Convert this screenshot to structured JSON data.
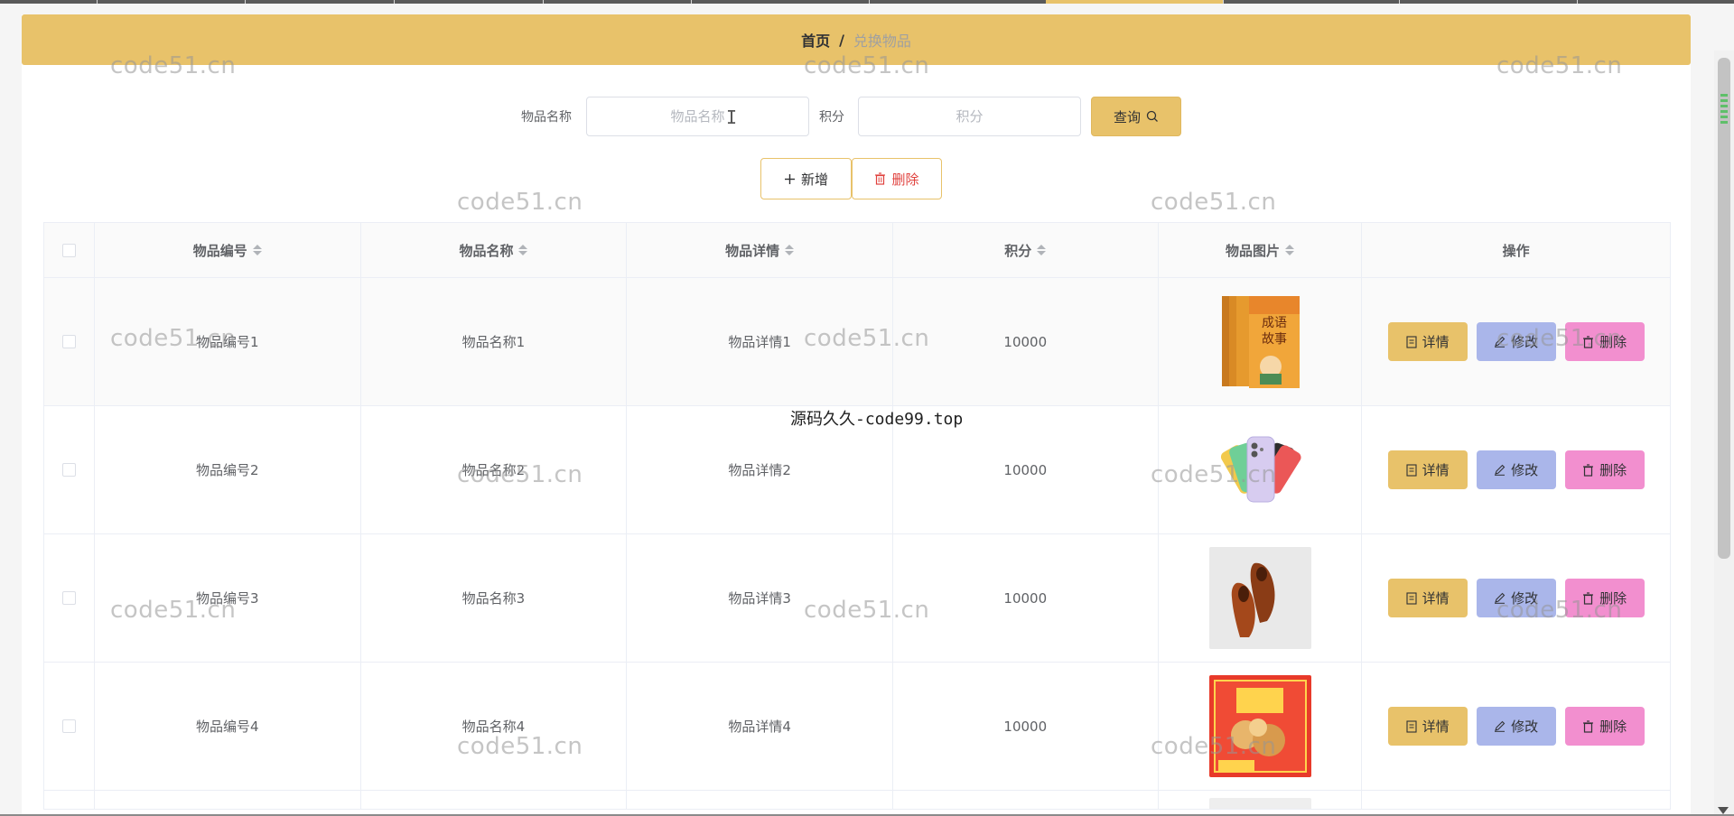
{
  "breadcrumb": {
    "home": "首页",
    "separator": "/",
    "current": "兑换物品"
  },
  "search": {
    "name_label": "物品名称",
    "name_placeholder": "物品名称",
    "points_label": "积分",
    "points_placeholder": "积分",
    "query_label": "查询"
  },
  "actions": {
    "add_label": "新增",
    "delete_label": "删除"
  },
  "table": {
    "headers": [
      "物品编号",
      "物品名称",
      "物品详情",
      "积分",
      "物品图片",
      "操作"
    ],
    "rows": [
      {
        "code": "物品编号1",
        "name": "物品名称1",
        "detail": "物品详情1",
        "points": "10000",
        "image": "book-image"
      },
      {
        "code": "物品编号2",
        "name": "物品名称2",
        "detail": "物品详情2",
        "points": "10000",
        "image": "phone-image"
      },
      {
        "code": "物品编号3",
        "name": "物品名称3",
        "detail": "物品详情3",
        "points": "10000",
        "image": "shoes-image"
      },
      {
        "code": "物品编号4",
        "name": "物品名称4",
        "detail": "物品详情4",
        "points": "10000",
        "image": "snack-box-image"
      }
    ],
    "row_buttons": {
      "detail": "详情",
      "edit": "修改",
      "delete": "删除"
    }
  },
  "watermark_text": "code51.cn",
  "center_overlay": "源码久久-code99.top",
  "colors": {
    "accent": "#e8c26a",
    "edit": "#aab6ea",
    "delete": "#f28fcf",
    "danger_text": "#e0403c"
  }
}
